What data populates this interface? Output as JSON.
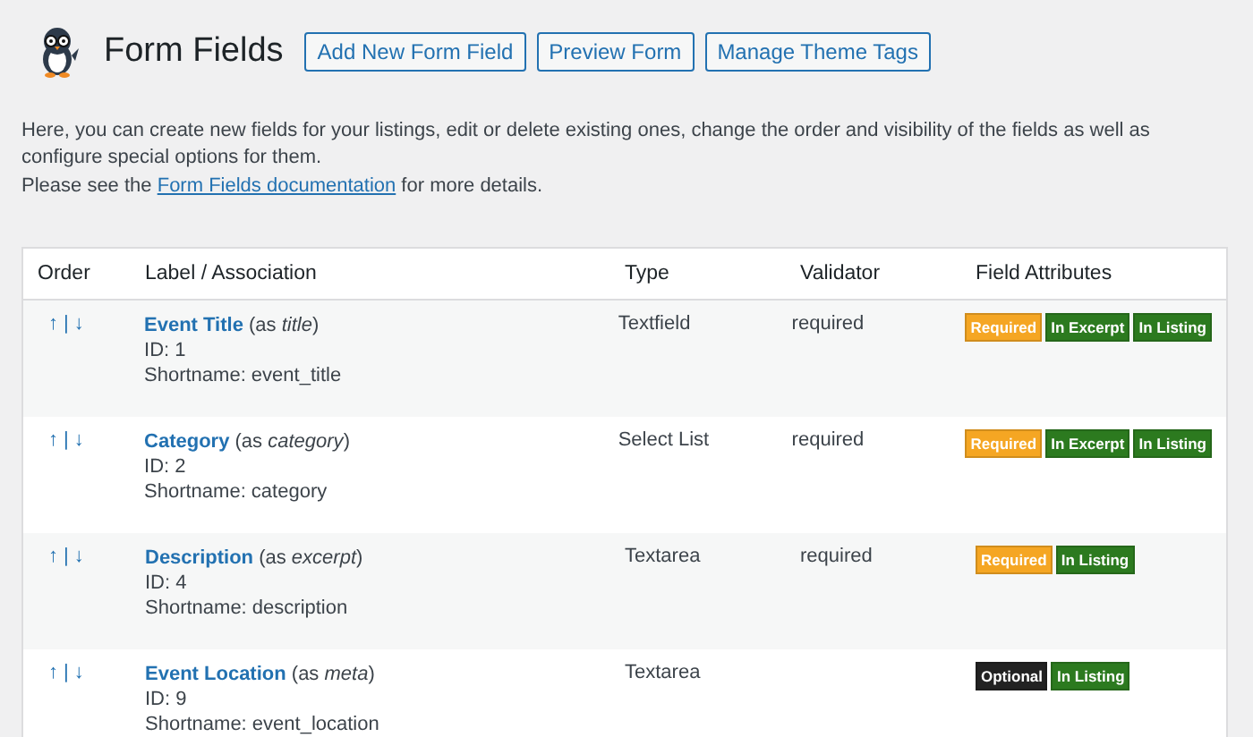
{
  "header": {
    "title": "Form Fields",
    "buttons": [
      "Add New Form Field",
      "Preview Form",
      "Manage Theme Tags"
    ]
  },
  "intro": "Here, you can create new fields for your listings, edit or delete existing ones, change the order and visibility of the fields as well as configure special options for them.",
  "doc_note": {
    "before": "Please see the",
    "link": "Form Fields documentation",
    "after": "for more details."
  },
  "table": {
    "columns": [
      "Order",
      "Label / Association",
      "Type",
      "Validator",
      "Field Attributes"
    ],
    "rows": [
      {
        "up": "↑",
        "separator": "|",
        "down": "↓",
        "label": "Event Title",
        "association": "(as *title*)",
        "id": "ID: 1",
        "shortname": "Shortname: event_title",
        "type": "Textfield",
        "validator": "required",
        "attributes": [
          {
            "text": "Required",
            "color": "#f5a623"
          },
          {
            "text": "In Excerpt",
            "color": "#2c7a1f"
          },
          {
            "text": "In Listing",
            "color": "#2c7a1f"
          }
        ]
      },
      {
        "up": "↑",
        "separator": "|",
        "down": "↓",
        "label": "Category",
        "association": "(as *category*)",
        "id": "ID: 2",
        "shortname": "Shortname: category",
        "type": "Select List",
        "validator": "required",
        "attributes": [
          {
            "text": "Required",
            "color": "#f5a623"
          },
          {
            "text": "In Excerpt",
            "color": "#2c7a1f"
          },
          {
            "text": "In Listing",
            "color": "#2c7a1f"
          }
        ]
      },
      {
        "up": "↑",
        "separator": "|",
        "down": "↓",
        "label": "Description",
        "association": "(as *excerpt*)",
        "id": "ID: 4",
        "shortname": "Shortname: description",
        "type": "Textarea",
        "validator": "required",
        "attributes": [
          {
            "text": "Required",
            "color": "#f5a623"
          },
          {
            "text": "In Listing",
            "color": "#2c7a1f"
          }
        ]
      },
      {
        "up": "↑",
        "separator": "|",
        "down": "↓",
        "label": "Event Location",
        "association": "(as *meta*)",
        "id": "ID: 9",
        "shortname": "Shortname: event_location",
        "type": "Textarea",
        "validator": "",
        "attributes": [
          {
            "text": "Optional",
            "color": "#222222"
          },
          {
            "text": "In Listing",
            "color": "#2c7a1f"
          }
        ]
      }
    ]
  }
}
